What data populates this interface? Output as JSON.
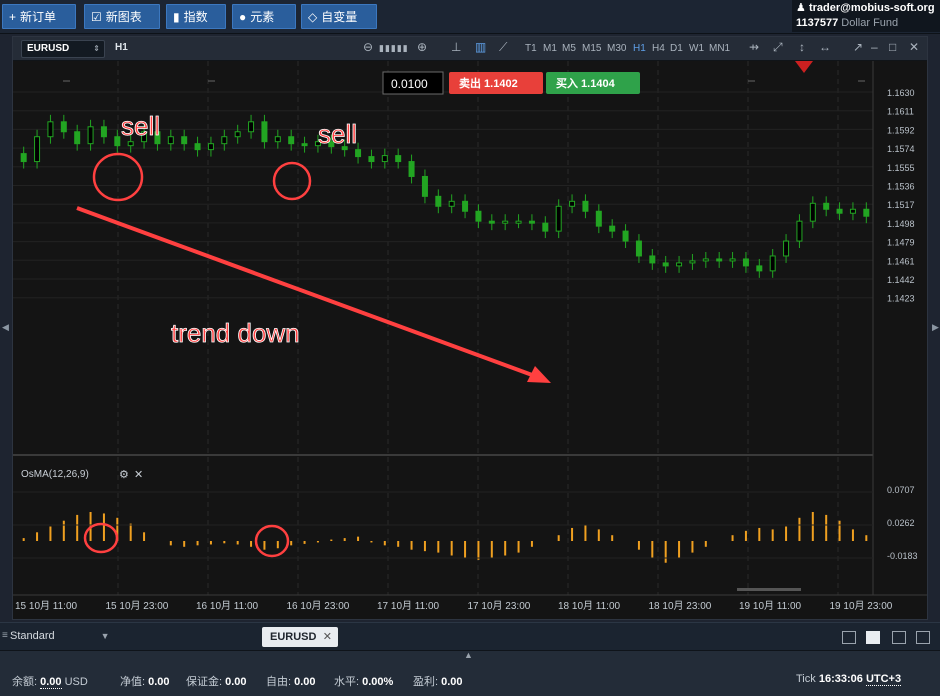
{
  "toolbar": {
    "new_order": "新订单",
    "new_chart": "新图表",
    "indicators": "指数",
    "elements": "元素",
    "variables": "自变量"
  },
  "account": {
    "user": "trader@mobius-soft.org",
    "number": "1137577",
    "name": "Dollar Fund"
  },
  "chart": {
    "symbol": "EURUSD",
    "timeframe": "H1",
    "timeframes": [
      "T1",
      "M1",
      "M5",
      "M15",
      "M30",
      "H1",
      "H4",
      "D1",
      "W1",
      "MN1"
    ],
    "active_timeframe": "H1",
    "lot": "0.0100",
    "sell_label": "卖出",
    "sell_price": "1.1402",
    "buy_label": "买入",
    "buy_price": "1.1404",
    "price_ticks": [
      "1.1630",
      "1.1611",
      "1.1592",
      "1.1574",
      "1.1555",
      "1.1536",
      "1.1517",
      "1.1498",
      "1.1479",
      "1.1461",
      "1.1442",
      "1.1423"
    ],
    "annotations": {
      "sell_1": "sell",
      "sell_2": "sell",
      "trend": "trend down"
    },
    "indicator_name": "OsMA(12,26,9)",
    "indicator_ticks": [
      "0.0707",
      "0.0262",
      "-0.0183"
    ],
    "time_labels": [
      "15 10月 11:00",
      "15 10月 23:00",
      "16 10月 11:00",
      "16 10月 23:00",
      "17 10月 11:00",
      "17 10月 23:00",
      "18 10月 11:00",
      "18 10月 23:00",
      "19 10月 11:00",
      "19 10月 23:00"
    ],
    "colors": {
      "up": "#22a522",
      "down": "#22a522",
      "osma": "#f0a020",
      "annotation": "#ff4040",
      "sell": "#e8403a",
      "buy": "#2fa24a"
    }
  },
  "bottom": {
    "workspace": "Standard",
    "tab": "EURUSD"
  },
  "status": {
    "balance_label": "余额:",
    "balance": "0.00",
    "currency": "USD",
    "equity_label": "净值:",
    "equity": "0.00",
    "margin_label": "保证金:",
    "margin": "0.00",
    "free_label": "自由:",
    "free": "0.00",
    "level_label": "水平:",
    "level": "0.00%",
    "profit_label": "盈利:",
    "profit": "0.00",
    "tick_label": "Tick",
    "time": "16:33:06",
    "tz": "UTC+3"
  }
}
